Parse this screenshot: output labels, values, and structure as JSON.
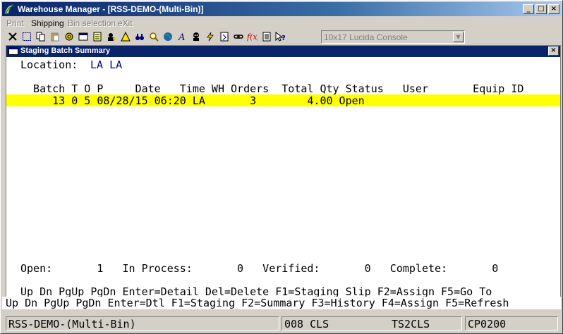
{
  "window": {
    "title": "Warehouse Manager - [RSS-DEMO-(Multi-Bin)]",
    "controls": [
      "_",
      "□",
      "×"
    ]
  },
  "menu": [
    {
      "label": "Print",
      "enabled": false
    },
    {
      "label": "Shipping",
      "enabled": true
    },
    {
      "label": "Bin selection",
      "enabled": false
    },
    {
      "label": "eXit",
      "enabled": false
    }
  ],
  "toolbar": {
    "icons": [
      "close-x-icon",
      "select-icon",
      "copy-icon",
      "paste-icon",
      "settings-icon",
      "properties-icon",
      "notes-icon",
      "user-lookup-icon",
      "alert-icon",
      "binoculars-icon",
      "search-icon",
      "globe-icon",
      "font-icon",
      "agent-icon",
      "lightning-icon",
      "script-icon",
      "link-icon",
      "function-icon",
      "list-icon",
      "help-pointer-icon"
    ],
    "font_combo": "10x17 Lucida Console"
  },
  "child": {
    "title": "Staging Batch Summary",
    "location_label": "Location:",
    "location_value": "LA LA",
    "table": {
      "headers": [
        "Batch",
        "T",
        "O",
        "P",
        "Date",
        "Time",
        "WH",
        "Orders",
        "Total Qty",
        "Status",
        "User",
        "Equip ID"
      ],
      "header_line": "  Batch T O P     Date   Time WH Orders  Total Qty Status   User       Equip ID",
      "rows": [
        {
          "batch": "13",
          "t": "0",
          "p": "5",
          "date": "08/28/15",
          "time": "06:20",
          "wh": "LA",
          "orders": "3",
          "total_qty": "4.00",
          "status": "Open",
          "user": "",
          "equip_id": ""
        }
      ],
      "row_lines": [
        "     13 0 5 08/28/15 06:20 LA       3        4.00 Open"
      ]
    },
    "totals_line": "Open:       1   In Process:       0   Verified:       0   Complete:       0",
    "totals": {
      "open": "1",
      "in_process": "0",
      "verified": "0",
      "complete": "0"
    },
    "keys_line": "Up Dn PgUp PgDn Enter=Detail Del=Delete F1=Staging Slip F2=Assign F5=Go To"
  },
  "fkey_line": "Up Dn PgUp PgDn Enter=Dtl F1=Staging F2=Summary F3=History F4=Assign F5=Refresh",
  "status_bar": [
    "RSS-DEMO-(Multi-Bin)",
    "008 CLS",
    "TS2CLS",
    "CP0200"
  ],
  "colors": {
    "highlight": "#ffff00",
    "title_bar": "#0a246a",
    "location_value": "#000080"
  }
}
